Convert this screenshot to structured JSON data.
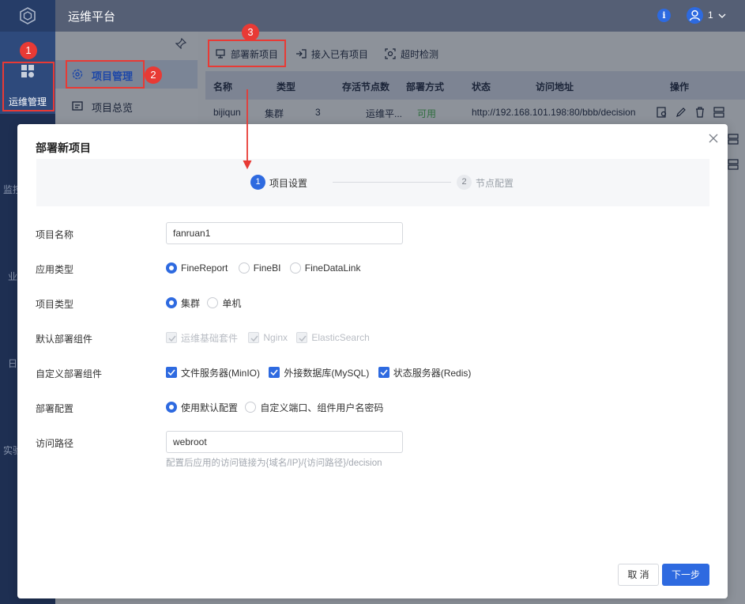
{
  "app": {
    "title": "运维平台",
    "user_count": "1"
  },
  "leftnav": {
    "active_label": "运维管理",
    "partial_labels": [
      "监控",
      "业",
      "日",
      "实验"
    ]
  },
  "subnav": {
    "items": [
      {
        "label": "项目管理",
        "icon": "gear-icon",
        "active": true
      },
      {
        "label": "项目总览",
        "icon": "overview-icon",
        "active": false
      }
    ]
  },
  "toolbar": {
    "deploy_new": "部署新项目",
    "import_existing": "接入已有项目",
    "timeout_check": "超时检测"
  },
  "table": {
    "headers": [
      "名称",
      "类型",
      "存活节点数",
      "部署方式",
      "状态",
      "访问地址",
      "操作"
    ],
    "rows": [
      {
        "name": "bijiqun",
        "type": "集群",
        "alive_nodes": "3",
        "deploy": "运维平...",
        "status": "可用",
        "url": "http://192.168.101.198:80/bbb/decision"
      }
    ]
  },
  "annotations": [
    "1",
    "2",
    "3"
  ],
  "modal": {
    "title": "部署新项目",
    "steps": [
      {
        "num": "1",
        "label": "项目设置",
        "active": true
      },
      {
        "num": "2",
        "label": "节点配置",
        "active": false
      }
    ],
    "fields": {
      "project_name": {
        "label": "项目名称",
        "value": "fanruan1"
      },
      "app_type": {
        "label": "应用类型",
        "options": [
          "FineReport",
          "FineBI",
          "FineDataLink"
        ],
        "selected": "FineReport"
      },
      "project_type": {
        "label": "项目类型",
        "options": [
          "集群",
          "单机"
        ],
        "selected": "集群"
      },
      "default_components": {
        "label": "默认部署组件",
        "options": [
          "运维基础套件",
          "Nginx",
          "ElasticSearch"
        ]
      },
      "custom_components": {
        "label": "自定义部署组件",
        "options": [
          "文件服务器(MinIO)",
          "外接数据库(MySQL)",
          "状态服务器(Redis)"
        ]
      },
      "deploy_config": {
        "label": "部署配置",
        "options": [
          "使用默认配置",
          "自定义端口、组件用户名密码"
        ],
        "selected": "使用默认配置"
      },
      "access_path": {
        "label": "访问路径",
        "value": "webroot",
        "hint": "配置后应用的访问链接为{域名/IP}/{访问路径}/decision"
      }
    },
    "buttons": {
      "cancel": "取 消",
      "next": "下一步"
    }
  },
  "colors": {
    "accent": "#2e6ae0",
    "annotation": "#e83a35",
    "nav": "#1e2f52"
  }
}
